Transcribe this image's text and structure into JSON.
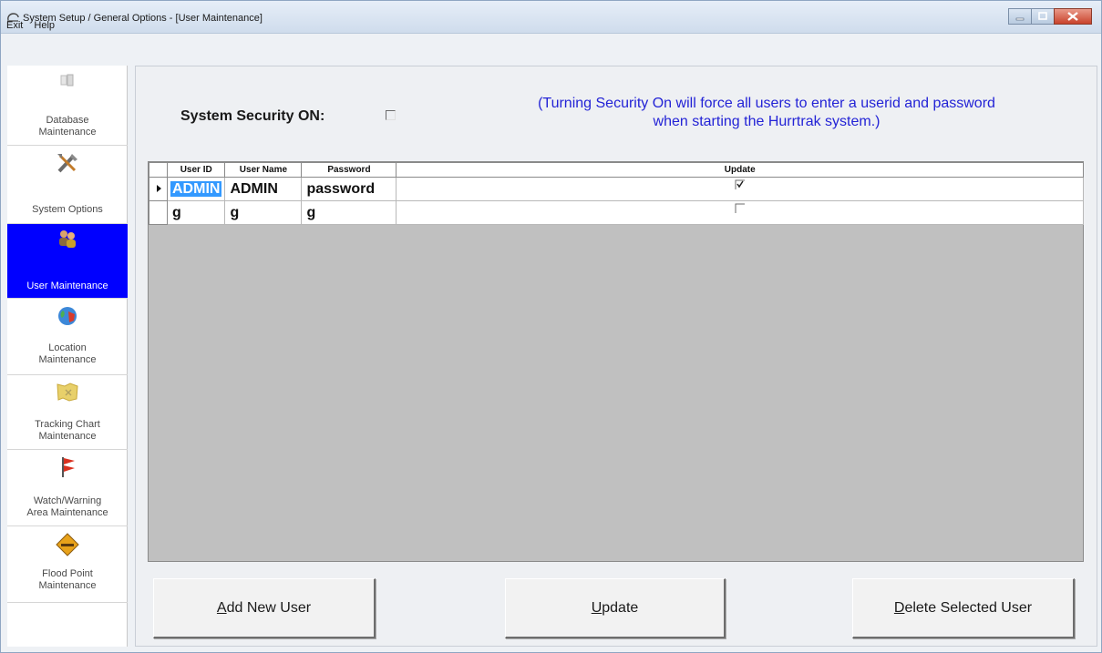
{
  "window": {
    "title": "System Setup / General Options - [User Maintenance]"
  },
  "menu": [
    "Exit",
    "Help"
  ],
  "sidebar": {
    "items": [
      {
        "label_line1": "Database",
        "label_line2": "Maintenance",
        "icon": "database-icon",
        "active": false
      },
      {
        "label_line1": "System Options",
        "label_line2": "",
        "icon": "tools-icon",
        "active": false
      },
      {
        "label_line1": "User Maintenance",
        "label_line2": "",
        "icon": "users-icon",
        "active": true
      },
      {
        "label_line1": "Location",
        "label_line2": "Maintenance",
        "icon": "globe-icon",
        "active": false
      },
      {
        "label_line1": "Tracking Chart",
        "label_line2": "Maintenance",
        "icon": "map-icon",
        "active": false
      },
      {
        "label_line1": "Watch/Warning",
        "label_line2": "Area Maintenance",
        "icon": "warning-flag-icon",
        "active": false
      },
      {
        "label_line1": "Flood Point",
        "label_line2": "Maintenance",
        "icon": "flood-sign-icon",
        "active": false
      }
    ]
  },
  "security": {
    "label": "System Security ON:",
    "checked": false,
    "notice_line1": "(Turning Security On will force all users to enter a userid and password",
    "notice_line2": "when starting the Hurrtrak system.)"
  },
  "grid": {
    "columns": [
      "User ID",
      "User Name",
      "Password",
      "Update"
    ],
    "rows": [
      {
        "user_id": "ADMIN",
        "user_name": "ADMIN",
        "password": "password",
        "update": true,
        "current": true
      },
      {
        "user_id": "g",
        "user_name": "g",
        "password": "g",
        "update": false,
        "current": false
      }
    ]
  },
  "buttons": {
    "add_pre": "",
    "add_key": "A",
    "add_post": "dd New User",
    "update_key": "U",
    "update_post": "pdate",
    "delete_key": "D",
    "delete_post": "elete Selected User"
  }
}
